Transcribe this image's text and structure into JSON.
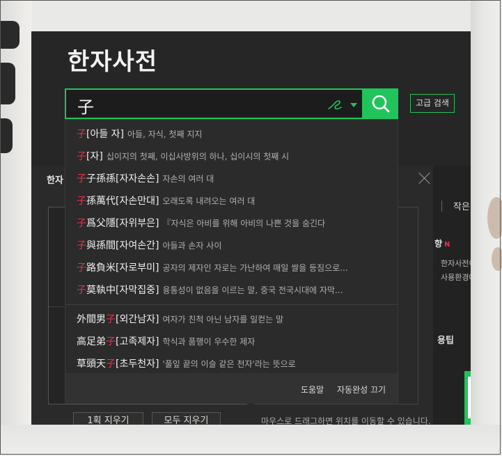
{
  "dictionary": {
    "title": "한자사전",
    "search": {
      "value": "子"
    },
    "advanced_search_label": "고급 검색"
  },
  "handwriting_panel": {
    "tab_label": "한자",
    "clear_one_label": "1획 지우기",
    "clear_all_label": "모두 지우기",
    "hint": "마우스로 드래그하면 위치를 이동할 수 있습니다."
  },
  "side_panel": {
    "small_label": "작은",
    "notice_heading": "향",
    "new_badge": "N",
    "line1": "한자사전이",
    "line2": "사용환경에",
    "tip_heading": "용팁"
  },
  "suggestions": [
    {
      "pre": "",
      "hl": "子",
      "post": "[아들 자]",
      "definition": "아들, 자식, 첫째 지지"
    },
    {
      "pre": "",
      "hl": "子",
      "post": "[자]",
      "definition": "십이지의 첫째, 이십사방위의 하나, 십이시의 첫째 시"
    },
    {
      "pre": "",
      "hl": "子",
      "post": "子孫孫[자자손손]",
      "definition": "자손의 여러 대"
    },
    {
      "pre": "",
      "hl": "子",
      "post": "孫萬代[자손만대]",
      "definition": "오래도록 내려오는 여러 대"
    },
    {
      "pre": "",
      "hl": "子",
      "post": "爲父隱[자위부은]",
      "definition": "『자식은 아비를 위해 아비의 나쁜 것을 숨긴다"
    },
    {
      "pre": "",
      "hl": "子",
      "post": "與孫間[자여손간]",
      "definition": "아들과 손자 사이"
    },
    {
      "pre": "",
      "hl": "子",
      "post": "路負米[자로부미]",
      "definition": "공자의 제자인 자로는 가난하여 매일 쌀을 등짐으로..."
    },
    {
      "pre": "",
      "hl": "子",
      "post": "莫執中[자막집중]",
      "definition": "융통성이 없음을 이르는 말, 중국 전국시대에 자막..."
    },
    {
      "pre": "外間男",
      "hl": "子",
      "post": "[외간남자]",
      "definition": "여자가 친척 아닌 남자를 일컫는 말"
    },
    {
      "pre": "高足弟",
      "hl": "子",
      "post": "[고족제자]",
      "definition": "학식과 품행이 우수한 제자"
    },
    {
      "pre": "草頭天",
      "hl": "子",
      "post": "[초두천자]",
      "definition": "'풀잎 끝의 이슬 같은 천자'라는 뜻으로"
    }
  ],
  "footer": {
    "help_label": "도움말",
    "autocomplete_off_label": "자동완성 끄기"
  },
  "colors": {
    "accent": "#21c45a",
    "highlight": "#e8304c",
    "panel": "#262626"
  },
  "icons": [
    "handwriting-icon",
    "search-icon",
    "close-icon"
  ]
}
